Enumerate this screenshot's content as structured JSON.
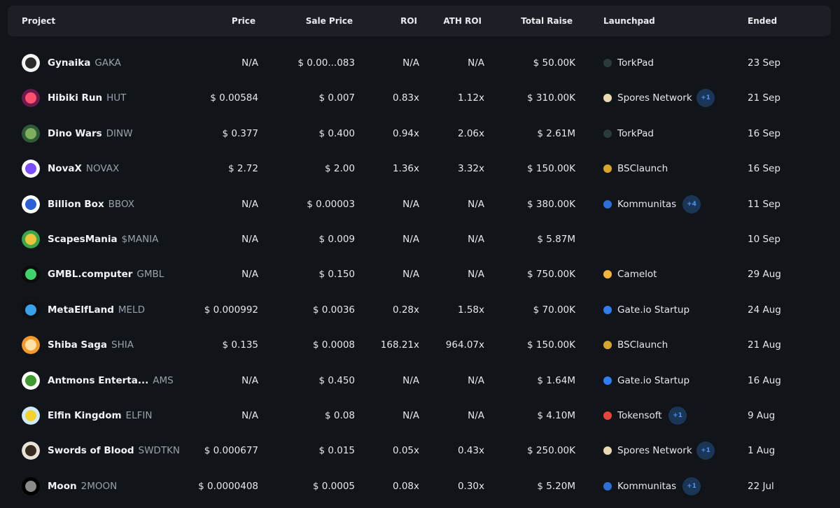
{
  "table": {
    "headers": {
      "project": "Project",
      "price": "Price",
      "sale_price": "Sale Price",
      "roi": "ROI",
      "ath_roi": "ATH ROI",
      "total_raise": "Total Raise",
      "launchpad": "Launchpad",
      "ended": "Ended"
    },
    "rows": [
      {
        "name": "Gynaika",
        "symbol": "GAKA",
        "price": "N/A",
        "sale_price": "$ 0.00...083",
        "roi": "N/A",
        "ath_roi": "N/A",
        "total_raise": "$ 50.00K",
        "launchpad": "TorkPad",
        "launchpad_icon": "torkpad-icon",
        "more": "",
        "ended": "23 Sep",
        "avatar_colors": [
          "#f5f5f5",
          "#2b2b2b"
        ]
      },
      {
        "name": "Hibiki Run",
        "symbol": "HUT",
        "price": "$ 0.00584",
        "sale_price": "$ 0.007",
        "roi": "0.83x",
        "ath_roi": "1.12x",
        "total_raise": "$ 310.00K",
        "launchpad": "Spores Network",
        "launchpad_icon": "spores-icon",
        "more": "+1",
        "ended": "21 Sep",
        "avatar_colors": [
          "#6b1a4e",
          "#ff4f6d"
        ]
      },
      {
        "name": "Dino Wars",
        "symbol": "DINW",
        "price": "$ 0.377",
        "sale_price": "$ 0.400",
        "roi": "0.94x",
        "ath_roi": "2.06x",
        "total_raise": "$ 2.61M",
        "launchpad": "TorkPad",
        "launchpad_icon": "torkpad-icon",
        "more": "",
        "ended": "16 Sep",
        "avatar_colors": [
          "#2f5a3a",
          "#7fae5c"
        ]
      },
      {
        "name": "NovaX",
        "symbol": "NOVAX",
        "price": "$ 2.72",
        "sale_price": "$ 2.00",
        "roi": "1.36x",
        "ath_roi": "3.32x",
        "total_raise": "$ 150.00K",
        "launchpad": "BSClaunch",
        "launchpad_icon": "bsclaunch-icon",
        "more": "",
        "ended": "16 Sep",
        "avatar_colors": [
          "#ffffff",
          "#7b4dff"
        ]
      },
      {
        "name": "Billion Box",
        "symbol": "BBOX",
        "price": "N/A",
        "sale_price": "$ 0.00003",
        "roi": "N/A",
        "ath_roi": "N/A",
        "total_raise": "$ 380.00K",
        "launchpad": "Kommunitas",
        "launchpad_icon": "kommunitas-icon",
        "more": "+4",
        "ended": "11 Sep",
        "avatar_colors": [
          "#ffffff",
          "#2a5fd6"
        ]
      },
      {
        "name": "ScapesMania",
        "symbol": "$MANIA",
        "price": "N/A",
        "sale_price": "$ 0.009",
        "roi": "N/A",
        "ath_roi": "N/A",
        "total_raise": "$ 5.87M",
        "launchpad": "",
        "launchpad_icon": "",
        "more": "",
        "ended": "10 Sep",
        "avatar_colors": [
          "#3aa84a",
          "#f0c43a"
        ]
      },
      {
        "name": "GMBL.computer",
        "symbol": "GMBL",
        "price": "N/A",
        "sale_price": "$ 0.150",
        "roi": "N/A",
        "ath_roi": "N/A",
        "total_raise": "$ 750.00K",
        "launchpad": "Camelot",
        "launchpad_icon": "camelot-icon",
        "more": "",
        "ended": "29 Aug",
        "avatar_colors": [
          "#0c0c0c",
          "#3fd16c"
        ]
      },
      {
        "name": "MetaElfLand",
        "symbol": "MELD",
        "price": "$ 0.000992",
        "sale_price": "$ 0.0036",
        "roi": "0.28x",
        "ath_roi": "1.58x",
        "total_raise": "$ 70.00K",
        "launchpad": "Gate.io Startup",
        "launchpad_icon": "gateio-icon",
        "more": "",
        "ended": "24 Aug",
        "avatar_colors": [
          "#0f0f14",
          "#3aa0e8"
        ]
      },
      {
        "name": "Shiba Saga",
        "symbol": "SHIA",
        "price": "$ 0.135",
        "sale_price": "$ 0.0008",
        "roi": "168.21x",
        "ath_roi": "964.07x",
        "total_raise": "$ 150.00K",
        "launchpad": "BSClaunch",
        "launchpad_icon": "bsclaunch-icon",
        "more": "",
        "ended": "21 Aug",
        "avatar_colors": [
          "#f39a2b",
          "#fde0a8"
        ]
      },
      {
        "name": "Antmons Enterta...",
        "symbol": "AMS",
        "price": "N/A",
        "sale_price": "$ 0.450",
        "roi": "N/A",
        "ath_roi": "N/A",
        "total_raise": "$ 1.64M",
        "launchpad": "Gate.io Startup",
        "launchpad_icon": "gateio-icon",
        "more": "",
        "ended": "16 Aug",
        "avatar_colors": [
          "#ffffff",
          "#3f9b2e"
        ]
      },
      {
        "name": "Elfin Kingdom",
        "symbol": "ELFIN",
        "price": "N/A",
        "sale_price": "$ 0.08",
        "roi": "N/A",
        "ath_roi": "N/A",
        "total_raise": "$ 4.10M",
        "launchpad": "Tokensoft",
        "launchpad_icon": "tokensoft-icon",
        "more": "+1",
        "ended": "9 Aug",
        "avatar_colors": [
          "#cfe9ff",
          "#f2d32e"
        ]
      },
      {
        "name": "Swords of Blood",
        "symbol": "SWDTKN",
        "price": "$ 0.000677",
        "sale_price": "$ 0.015",
        "roi": "0.05x",
        "ath_roi": "0.43x",
        "total_raise": "$ 250.00K",
        "launchpad": "Spores Network",
        "launchpad_icon": "spores-icon",
        "more": "+1",
        "ended": "1 Aug",
        "avatar_colors": [
          "#e9e2d6",
          "#3a2b22"
        ]
      },
      {
        "name": "Moon",
        "symbol": "2MOON",
        "price": "$ 0.0000408",
        "sale_price": "$ 0.0005",
        "roi": "0.08x",
        "ath_roi": "0.30x",
        "total_raise": "$ 5.20M",
        "launchpad": "Kommunitas",
        "launchpad_icon": "kommunitas-icon",
        "more": "+1",
        "ended": "22 Jul",
        "avatar_colors": [
          "#000000",
          "#8a8a8a"
        ]
      }
    ]
  },
  "colors": {
    "background": "#111418",
    "header_bg": "#1c1f25",
    "more_badge_bg": "#1a3556",
    "more_badge_text": "#4f95f0"
  }
}
